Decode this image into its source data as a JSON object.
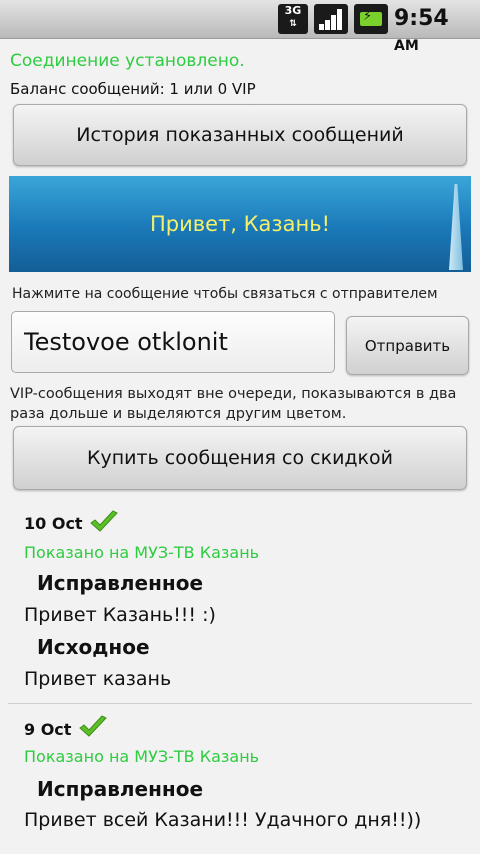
{
  "status": {
    "network": "3G",
    "time": "9:54",
    "ampm": "AM",
    "battery_color": "#7ad12c"
  },
  "connection_status": "Соединение установлено.",
  "balance": "Баланс сообщений: 1 или 0 VIP",
  "history_button": "История показанных сообщений",
  "banner_text": "Привет, Казань!",
  "hint": "Нажмите на сообщение чтобы связаться с отправителем",
  "message_input_value": "Testovoe otklonit",
  "send_button": "Отправить",
  "vip_note": "VIP-сообщения выходят вне очереди, показываются в два раза дольше и выделяются другим цветом.",
  "buy_button": "Купить сообщения со скидкой",
  "colors": {
    "accent_green": "#2ecc40",
    "banner_text": "#f5f06a",
    "check": "#5cbf2a"
  },
  "messages": [
    {
      "date": "10 Oct",
      "shown_on": "Показано на МУЗ-ТВ Казань",
      "corrected_label": "Исправленное",
      "corrected_text": "Привет Казань!!! :)",
      "original_label": "Исходное",
      "original_text": "Привет казань"
    },
    {
      "date": "9 Oct",
      "shown_on": "Показано на МУЗ-ТВ Казань",
      "corrected_label": "Исправленное",
      "corrected_text": "Привет всей Казани!!! Удачного дня!!))"
    }
  ]
}
